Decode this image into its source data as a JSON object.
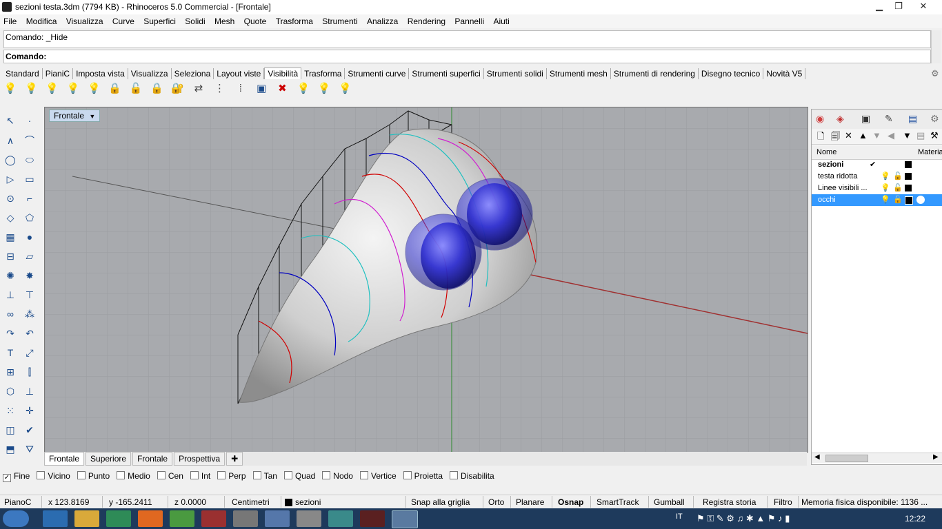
{
  "window": {
    "title": "sezioni testa.3dm (7794 KB) - Rhinoceros 5.0 Commercial - [Frontale]"
  },
  "menu": [
    "File",
    "Modifica",
    "Visualizza",
    "Curve",
    "Superfici",
    "Solidi",
    "Mesh",
    "Quote",
    "Trasforma",
    "Strumenti",
    "Analizza",
    "Rendering",
    "Pannelli",
    "Aiuti"
  ],
  "command": {
    "history": "Comando: _Hide",
    "prompt": "Comando:"
  },
  "toolbar_tabs": [
    "Standard",
    "PianiC",
    "Imposta vista",
    "Visualizza",
    "Seleziona",
    "Layout viste",
    "Visibilità",
    "Trasforma",
    "Strumenti curve",
    "Strumenti superfici",
    "Strumenti solidi",
    "Strumenti mesh",
    "Strumenti di rendering",
    "Disegno tecnico",
    "Novità V5"
  ],
  "active_toolbar_tab": "Visibilità",
  "viewport": {
    "label": "Frontale"
  },
  "viewport_tabs": [
    "Frontale",
    "Superiore",
    "Frontale",
    "Prospettiva"
  ],
  "layers_panel": {
    "header_name": "Nome",
    "header_material": "Materia",
    "layers": [
      {
        "name": "sezioni",
        "current": true
      },
      {
        "name": "testa ridotta"
      },
      {
        "name": "Linee visibili ..."
      },
      {
        "name": "occhi",
        "selected": true
      }
    ]
  },
  "osnap": [
    {
      "label": "Fine",
      "checked": true
    },
    {
      "label": "Vicino"
    },
    {
      "label": "Punto"
    },
    {
      "label": "Medio"
    },
    {
      "label": "Cen"
    },
    {
      "label": "Int"
    },
    {
      "label": "Perp"
    },
    {
      "label": "Tan"
    },
    {
      "label": "Quad"
    },
    {
      "label": "Nodo"
    },
    {
      "label": "Vertice"
    },
    {
      "label": "Proietta"
    },
    {
      "label": "Disabilita"
    }
  ],
  "status": {
    "cplane": "PianoC",
    "x": "x 123.8169",
    "y": "y -165.2411",
    "z": "z 0.0000",
    "units": "Centimetri",
    "layer": "sezioni",
    "snap": "Snap alla griglia",
    "ortho": "Orto",
    "planar": "Planare",
    "osnap": "Osnap",
    "smarttrack": "SmartTrack",
    "gumball": "Gumball",
    "history": "Registra storia",
    "filter": "Filtro",
    "memory": "Memoria fisica disponibile: 1136 ..."
  },
  "taskbar": {
    "lang": "IT",
    "clock": "12:22"
  },
  "colors": {
    "selection": "#3399ff",
    "viewport_bg": "#a8aaae",
    "taskbar": "#1e3a5c"
  }
}
